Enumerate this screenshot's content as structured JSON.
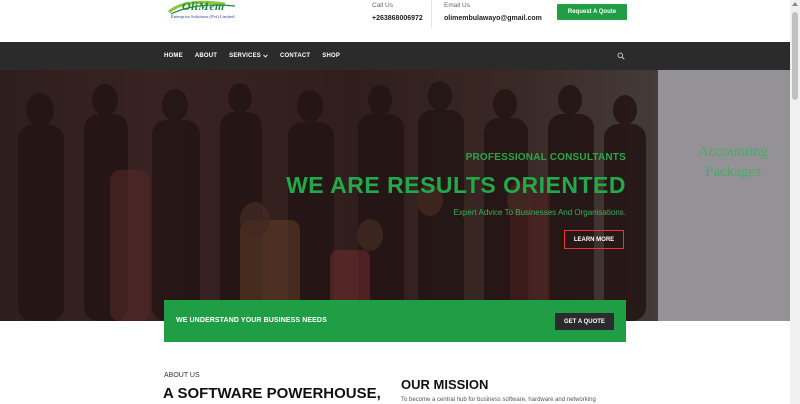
{
  "header": {
    "logo_text": "OliMem",
    "logo_subtext": "Enterprise Solutions (Pvt) Limited",
    "call_label": "Call Us",
    "call_value": "+263868006972",
    "email_label": "Email Us",
    "email_value": "olimembulawayo@gmail.com",
    "quote_button": "Request A Qoute"
  },
  "nav": {
    "items": [
      "HOME",
      "ABOUT",
      "SERVICES",
      "CONTACT",
      "SHOP"
    ]
  },
  "hero": {
    "subtitle": "PROFESSIONAL CONSULTANTS",
    "title": "WE ARE RESULTS ORIENTED",
    "description": "Expert Advice To Businesses And Organisations.",
    "button": "LEARN MORE",
    "board_text": "Accounting Packages"
  },
  "band": {
    "text": "WE UNDERSTAND YOUR BUSINESS NEEDS",
    "button": "GET A QUOTE"
  },
  "about": {
    "kicker": "ABOUT US",
    "title": "A SOFTWARE POWERHOUSE,"
  },
  "mission": {
    "title": "OUR MISSION",
    "text": "To become a central hub for business software, hardware and networking"
  },
  "colors": {
    "brand_green": "#1f9e45",
    "nav_dark": "#2b2b2b",
    "hero_red_border": "#e33333"
  }
}
